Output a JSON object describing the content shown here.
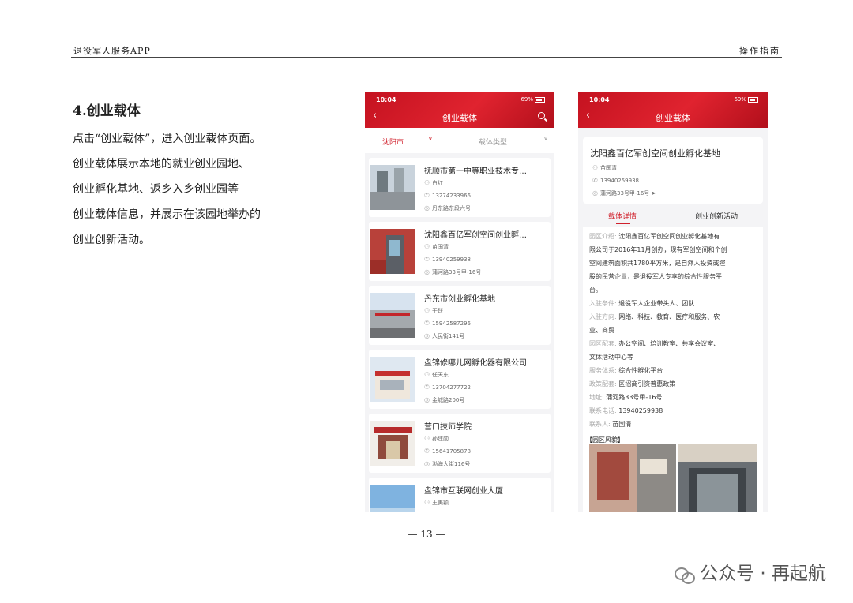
{
  "header": {
    "left": "退役军人服务APP",
    "right": "操作指南"
  },
  "section": {
    "title": "4.创业载体",
    "lines": [
      "点击“创业载体”，进入创业载体页面。",
      "创业载体展示本地的就业创业园地、",
      "创业孵化基地、返乡入乡创业园等",
      "创业载体信息，并展示在该园地举办的",
      "创业创新活动。"
    ]
  },
  "phone1": {
    "time": "10:04",
    "status": "69%",
    "title": "创业载体",
    "filter_city": "沈阳市",
    "filter_type": "载体类型",
    "items": [
      {
        "name": "抚顺市第一中等职业技术专…",
        "contact": "白红",
        "phone": "13274233966",
        "address": "丹东路东段六号"
      },
      {
        "name": "沈阳鑫百亿军创空间创业孵…",
        "contact": "苗国清",
        "phone": "13940259938",
        "address": "蒲河路33号甲-16号"
      },
      {
        "name": "丹东市创业孵化基地",
        "contact": "于跃",
        "phone": "15942587296",
        "address": "人民街141号"
      },
      {
        "name": "盘锦修哪儿网孵化器有限公司",
        "contact": "任天东",
        "phone": "13704277722",
        "address": "金城路200号"
      },
      {
        "name": "营口技师学院",
        "contact": "孙建勋",
        "phone": "15641705878",
        "address": "渤海大街116号"
      },
      {
        "name": "盘锦市互联网创业大厦",
        "contact": "王美颖",
        "phone": "",
        "address": ""
      }
    ]
  },
  "phone2": {
    "time": "10:04",
    "status": "69%",
    "title": "创业载体",
    "org": {
      "name": "沈阳鑫百亿军创空间创业孵化基地",
      "contact": "苗国清",
      "phone": "13940259938",
      "address": "蒲河路33号甲-16号"
    },
    "tab_detail": "载体详情",
    "tab_activity": "创业创新活动",
    "details": {
      "intro_label": "园区介绍:",
      "intro_l1": "沈阳鑫百亿军创空间创业孵化基地有",
      "intro_l2": "限公司于2016年11月创办，现有军创空间和个创",
      "intro_l3": "空间建筑面积共1780平方米，是自然人投资或控",
      "intro_l4": "股的民营企业，是退役军人专享的综合性服务平",
      "intro_l5": "台。",
      "cond_label": "入驻条件:",
      "cond": "退役军人企业带头人、团队",
      "dir_label": "入驻方向:",
      "dir_l1": "网络、科技、教育、医疗和服务、农",
      "dir_l2": "业、商贸",
      "fac_label": "园区配套:",
      "fac_l1": "办公空间、培训教室、共享会议室、",
      "fac_l2": "文体活动中心等",
      "svc_label": "服务体系:",
      "svc": "综合性孵化平台",
      "pol_label": "政策配套:",
      "pol": "区招商引资普惠政策",
      "addr_label": "地址:",
      "addr": "蒲河路33号甲-16号",
      "tel_label": "联系电话:",
      "tel": "13940259938",
      "person_label": "联系人:",
      "person": "苗国清"
    },
    "gallery_title": "【园区风貌】"
  },
  "footer": {
    "page": "— 13 —"
  },
  "watermark": {
    "text": "公众号 · 再起航"
  }
}
